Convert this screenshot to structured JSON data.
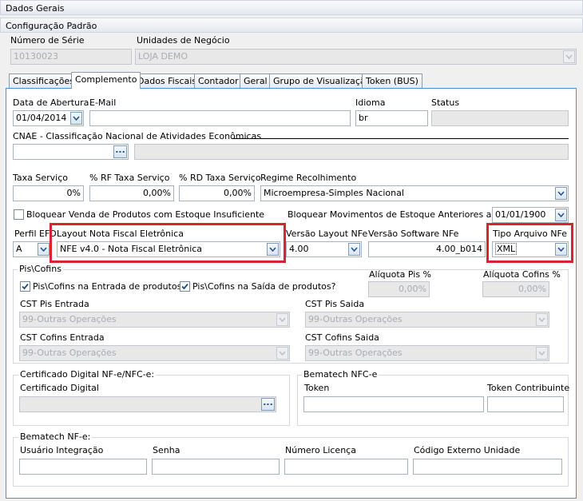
{
  "window_title": "Dados Gerais",
  "config_section": "Configuração Padrão",
  "numero_serie": {
    "label": "Número de Série",
    "value": "10130023"
  },
  "unidades_negocio": {
    "label": "Unidades de Negócio",
    "value": "LOJA DEMO"
  },
  "tabs": [
    {
      "label": "Classificações"
    },
    {
      "label": "Complemento"
    },
    {
      "label": "Dados Fiscais"
    },
    {
      "label": "Contador"
    },
    {
      "label": "Geral"
    },
    {
      "label": "Grupo de Visualização"
    },
    {
      "label": "Token (BUS)"
    }
  ],
  "data_abertura": {
    "label": "Data de Abertura",
    "value": "01/04/2014"
  },
  "email": {
    "label": "E-Mail",
    "value": ""
  },
  "idioma": {
    "label": "Idioma",
    "value": "br"
  },
  "status": {
    "label": "Status",
    "value": ""
  },
  "cnae": {
    "label": "CNAE - Classificação Nacional de Atividades Econômicas",
    "code": "",
    "description": ""
  },
  "taxa_servico": {
    "label": "Taxa Serviço",
    "value": "0%"
  },
  "rf_taxa": {
    "label": "% RF Taxa Serviço",
    "value": "0,00%"
  },
  "rd_taxa": {
    "label": "% RD Taxa Serviço",
    "value": "0,00%"
  },
  "regime": {
    "label": "Regime Recolhimento",
    "value": "Microempresa-Simples Nacional"
  },
  "bloquear_venda": {
    "label": "Bloquear Venda de Produtos com Estoque Insuficiente",
    "checked": false
  },
  "bloquear_mov": {
    "label": "Bloquear Movimentos de Estoque Anteriores ao Dia:",
    "value": "01/01/1900"
  },
  "perfil_efd": {
    "label": "Perfil EFD",
    "value": "A"
  },
  "layout_nf": {
    "label": "Layout Nota Fiscal Eletrônica",
    "value": "NFE v4.0 - Nota Fiscal Eletrônica"
  },
  "versao_layout": {
    "label": "Versão Layout NFe",
    "value": "4.00"
  },
  "versao_software": {
    "label": "Versão Software NFe",
    "value": "4.00_b014"
  },
  "tipo_arquivo": {
    "label": "Tipo Arquivo NFe",
    "value": "XML"
  },
  "pis_cofins": {
    "title": "Pis\\Cofins",
    "entrada": {
      "label": "Pis\\Cofins na Entrada de produtos?",
      "checked": true
    },
    "saida": {
      "label": "Pis\\Cofins na Saída de produtos?",
      "checked": true
    },
    "aliquota_pis": {
      "label": "Alíquota Pis %",
      "value": "0,00%"
    },
    "aliquota_cofins": {
      "label": "Alíquota Cofins %",
      "value": "0,00%"
    },
    "cst_pis_entrada": {
      "label": "CST Pis Entrada",
      "value": "99-Outras Operações"
    },
    "cst_pis_saida": {
      "label": "CST Pis Saida",
      "value": "99-Outras Operações"
    },
    "cst_cofins_entrada": {
      "label": "CST Cofins Entrada",
      "value": "99-Outras Operações"
    },
    "cst_cofins_saida": {
      "label": "CST Cofins Saida",
      "value": "99-Outras Operações"
    }
  },
  "certificado": {
    "title": "Certificado Digital NF-e/NFC-e:",
    "label": "Certificado Digital",
    "value": ""
  },
  "bematech_nfce": {
    "title": "Bematech NFC-e",
    "token_label": "Token",
    "token_contribuinte_label": "Token Contribuinte"
  },
  "bematech_nfe": {
    "title": "Bematech NF-e:",
    "usuario_label": "Usuário Integração",
    "senha_label": "Senha",
    "numero_licenca_label": "Número Licença",
    "codigo_externo_label": "Código Externo Unidade"
  },
  "colors": {
    "highlight": "#d9232f",
    "panel_border": "#4f8fd0",
    "disabled_bg": "#e8e8e8"
  }
}
